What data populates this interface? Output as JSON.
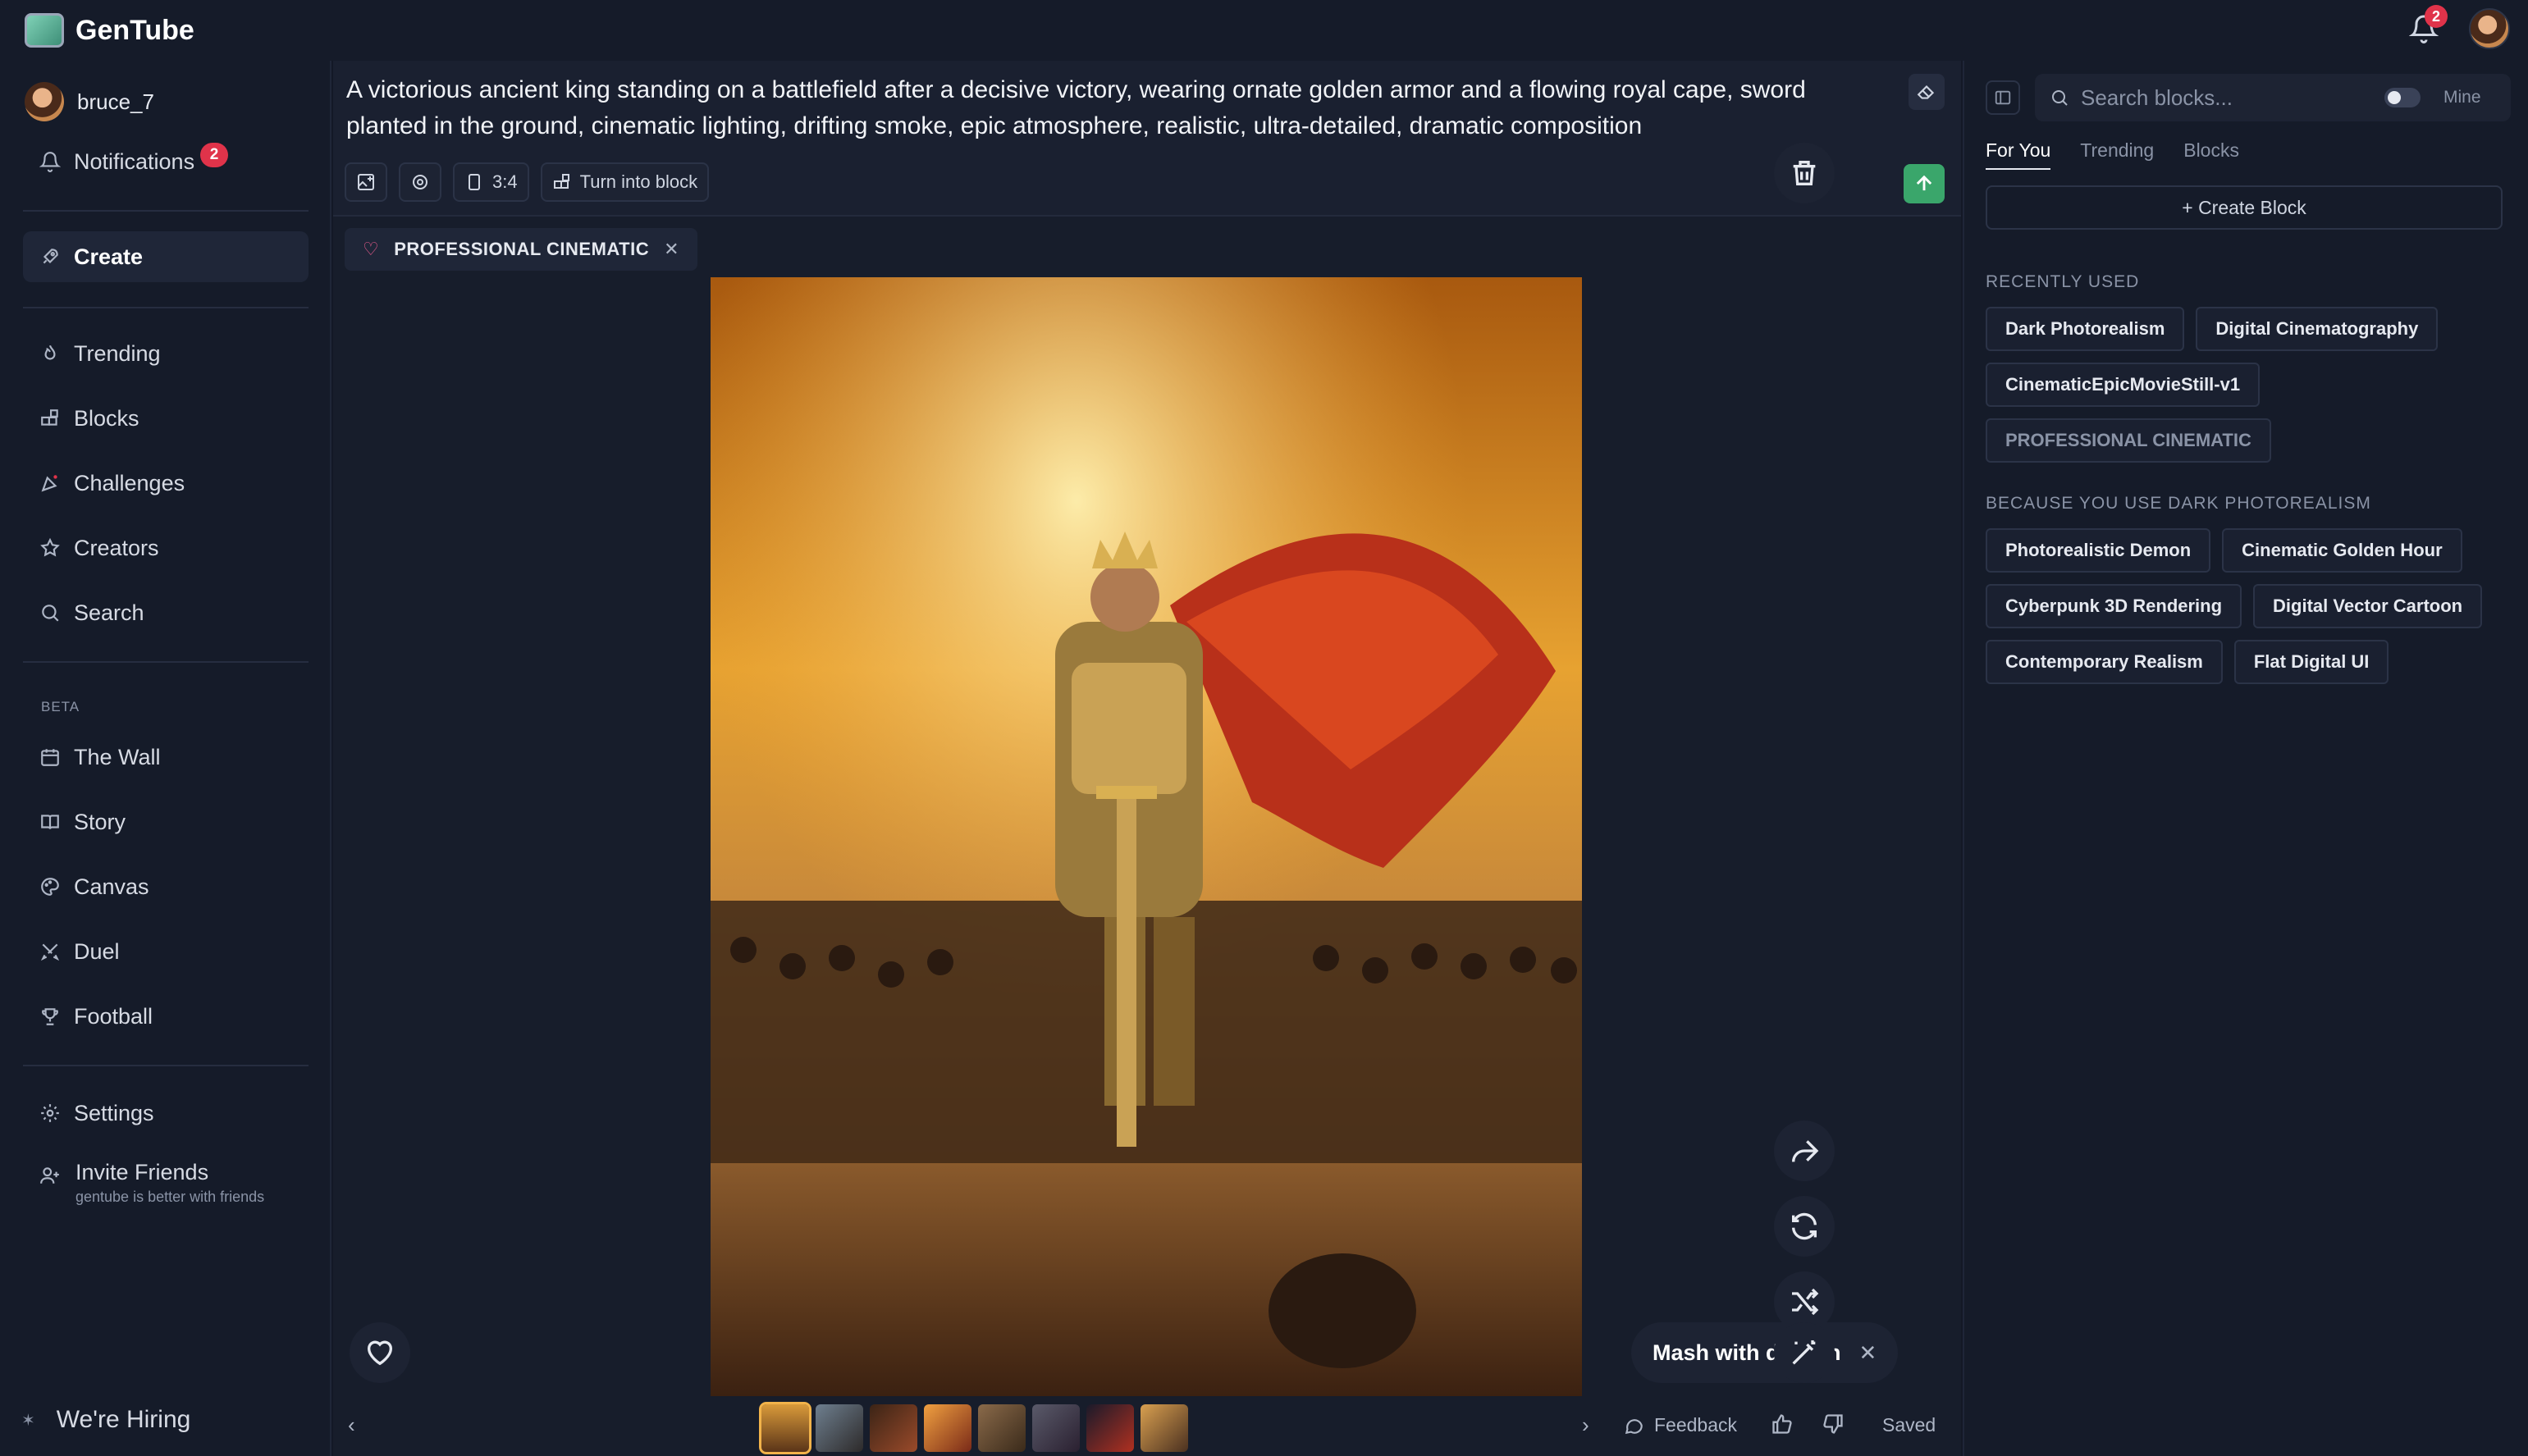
{
  "app": {
    "name": "GenTube",
    "notif_count": "2"
  },
  "user": {
    "username": "bruce_7"
  },
  "sidebar": {
    "notifications": {
      "label": "Notifications",
      "count": "2"
    },
    "create": "Create",
    "items": [
      {
        "label": "Trending",
        "icon": "flame-icon"
      },
      {
        "label": "Blocks",
        "icon": "blocks-icon"
      },
      {
        "label": "Challenges",
        "icon": "party-icon"
      },
      {
        "label": "Creators",
        "icon": "star-icon"
      },
      {
        "label": "Search",
        "icon": "search-icon"
      }
    ],
    "beta_label": "BETA",
    "beta_items": [
      {
        "label": "The Wall",
        "icon": "calendar-icon"
      },
      {
        "label": "Story",
        "icon": "book-icon"
      },
      {
        "label": "Canvas",
        "icon": "palette-icon"
      },
      {
        "label": "Duel",
        "icon": "swords-icon"
      },
      {
        "label": "Football",
        "icon": "trophy-icon"
      }
    ],
    "settings": "Settings",
    "invite_title": "Invite Friends",
    "invite_sub": "gentube is better with friends",
    "hiring": "We're Hiring"
  },
  "prompt": {
    "text": "A victorious ancient king standing on a battlefield after a decisive victory, wearing ornate golden armor and a flowing royal cape, sword planted in the ground, cinematic lighting, drifting smoke, epic atmosphere, realistic, ultra-detailed, dramatic composition",
    "aspect": "3:4",
    "turn_into_block": "Turn into block"
  },
  "active_block": "PROFESSIONAL CINEMATIC",
  "actions": {
    "mash_label": "Mash with dragon",
    "feedback": "Feedback",
    "saved": "Saved"
  },
  "right_panel": {
    "search_placeholder": "Search blocks...",
    "mine_label": "Mine",
    "tabs": [
      "For You",
      "Trending",
      "Blocks"
    ],
    "create_block": "+ Create Block",
    "recent_title": "RECENTLY USED",
    "recent": [
      "Dark Photorealism",
      "Digital Cinematography",
      "CinematicEpicMovieStill-v1",
      "PROFESSIONAL CINEMATIC"
    ],
    "because_title": "BECAUSE YOU USE DARK PHOTOREALISM",
    "because": [
      "Photorealistic Demon",
      "Cinematic Golden Hour",
      "Cyberpunk 3D Rendering",
      "Digital Vector Cartoon",
      "Contemporary Realism",
      "Flat Digital UI"
    ]
  },
  "colors": {
    "accent_green": "#3aa66b",
    "badge_red": "#e0334a",
    "bg": "#131826"
  }
}
